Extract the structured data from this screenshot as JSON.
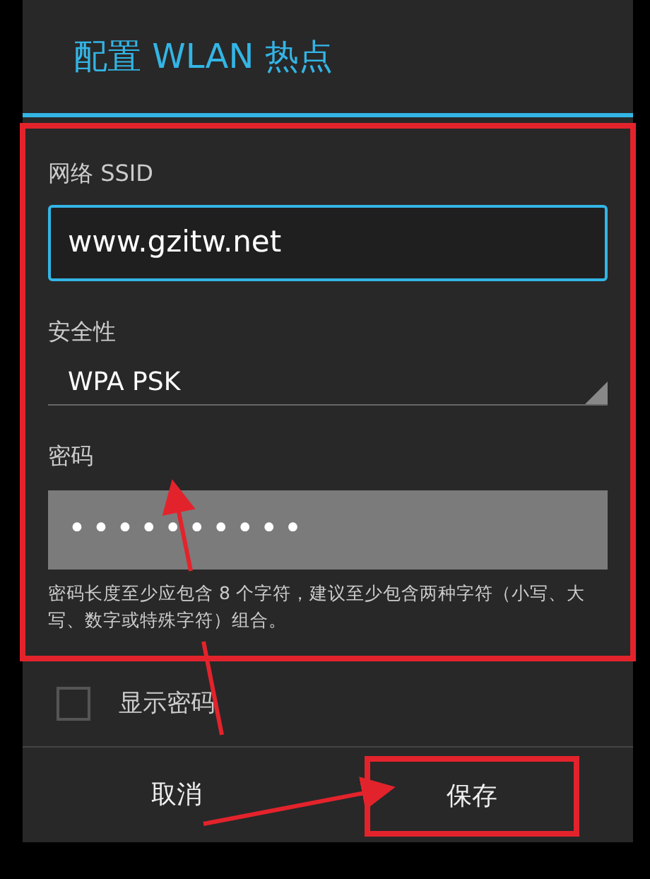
{
  "dialog": {
    "title": "配置 WLAN 热点"
  },
  "form": {
    "ssid": {
      "label": "网络 SSID",
      "value": "www.gzitw.net"
    },
    "security": {
      "label": "安全性",
      "value": "WPA PSK"
    },
    "password": {
      "label": "密码",
      "value": "••••••••••",
      "hint": "密码长度至少应包含 8 个字符，建议至少包含两种字符（小写、大写、数字或特殊字符）组合。"
    }
  },
  "show_password": {
    "label": "显示密码",
    "checked": false
  },
  "buttons": [
    {
      "label": "取消",
      "kind": "cancel"
    },
    {
      "label": "保存",
      "kind": "save"
    }
  ],
  "annotations": [
    {
      "kind": "form-frame"
    },
    {
      "kind": "save-frame"
    },
    {
      "kind": "password-arrow"
    },
    {
      "kind": "save-arrow"
    }
  ]
}
